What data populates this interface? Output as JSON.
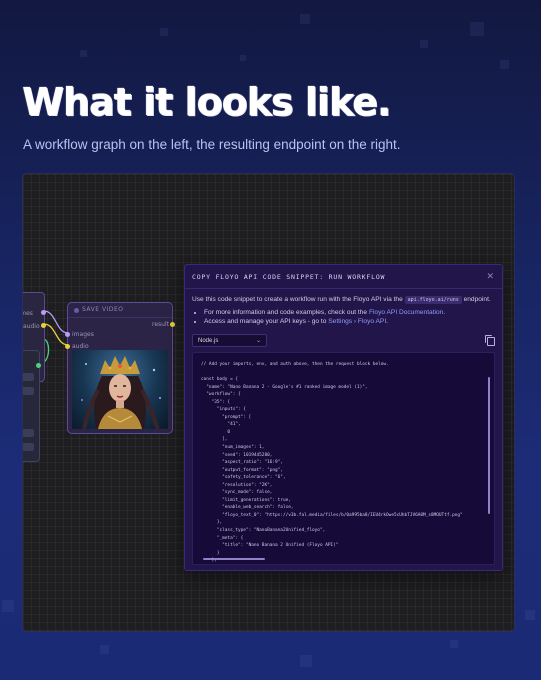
{
  "hero": {
    "title": "What it looks like.",
    "subtitle": "A workflow graph on the left, the resulting endpoint on the right."
  },
  "graph": {
    "left_node_ports": [
      "frames",
      "audio"
    ],
    "save_video_node": {
      "title": "SAVE VIDEO",
      "inputs": [
        "images",
        "audio"
      ],
      "output": "result"
    }
  },
  "modal": {
    "title": "COPY FLOYO API CODE SNIPPET: RUN WORKFLOW",
    "intro_prefix": "Use this code snippet to create a workflow run with the Floyo API via the ",
    "endpoint_pill": "api.floyo.ai/runs",
    "intro_suffix": " endpoint.",
    "bullet1_prefix": "For more information and code examples, check out the ",
    "bullet1_link": "Floyo API Documentation",
    "bullet1_suffix": ".",
    "bullet2_prefix": "Access and manage your API keys - go to ",
    "bullet2_link": "Settings › Floyo API",
    "bullet2_suffix": ".",
    "language": "Node.js",
    "code_lines": [
      "// Add your imports, env, and auth above, then the request block below.",
      "",
      "const body = {",
      "  \"name\": \"Nano Banana 2 - Google's #1 ranked image model (1)\",",
      "  \"workflow\": {",
      "    \"35\": {",
      "      \"inputs\": {",
      "        \"prompt\": [",
      "          \"41\",",
      "          0",
      "        ],",
      "        \"num_images\": 1,",
      "        \"seed\": 1019445280,",
      "        \"aspect_ratio\": \"16:9\",",
      "        \"output_format\": \"png\",",
      "        \"safety_tolerance\": \"6\",",
      "        \"resolution\": \"2K\",",
      "        \"sync_mode\": false,",
      "        \"limit_generations\": true,",
      "        \"enable_web_search\": false,",
      "        \"floyo_text_0\": \"https://v3b.fal.media/files/b/0a995ba8/IEU4rkOwe5cUhbTJV6A0M_s8MOUTtf.png\"",
      "      },",
      "      \"class_type\": \"NanoBanana2Unified_floyo\",",
      "      \"_meta\": {",
      "        \"title\": \"Nano Banana 2 Unified (Floyo API)\"",
      "      }",
      "    },"
    ]
  }
}
